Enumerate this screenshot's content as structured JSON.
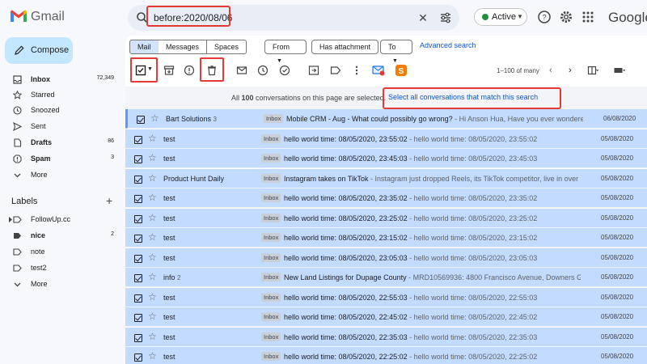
{
  "app": {
    "name": "Gmail",
    "google_wordmark": "Google"
  },
  "search": {
    "value": "before:2020/08/06"
  },
  "status": {
    "label": "Active"
  },
  "sidebar": {
    "compose_label": "Compose",
    "items": [
      {
        "label": "Inbox",
        "count": "72,349",
        "bold": true,
        "icon": "inbox-icon"
      },
      {
        "label": "Starred",
        "count": "",
        "bold": false,
        "icon": "star-icon"
      },
      {
        "label": "Snoozed",
        "count": "",
        "bold": false,
        "icon": "clock-icon"
      },
      {
        "label": "Sent",
        "count": "",
        "bold": false,
        "icon": "send-icon"
      },
      {
        "label": "Drafts",
        "count": "86",
        "bold": true,
        "icon": "draft-icon"
      },
      {
        "label": "Spam",
        "count": "3",
        "bold": true,
        "icon": "spam-icon"
      },
      {
        "label": "More",
        "count": "",
        "bold": false,
        "icon": "chevron-down-icon"
      }
    ],
    "labels_title": "Labels",
    "labels": [
      {
        "label": "FollowUp.cc",
        "count": "",
        "bold": false
      },
      {
        "label": "nice",
        "count": "2",
        "bold": true
      },
      {
        "label": "note",
        "count": "",
        "bold": false
      },
      {
        "label": "test2",
        "count": "",
        "bold": false
      },
      {
        "label": "More",
        "count": "",
        "bold": false
      }
    ]
  },
  "tabs": {
    "mail": "Mail",
    "messages": "Messages",
    "spaces": "Spaces"
  },
  "filters": {
    "from": "From",
    "has_attachment": "Has attachment",
    "to": "To",
    "advanced": "Advanced search"
  },
  "pager": {
    "text": "1–100 of many"
  },
  "banner": {
    "prefix": "All ",
    "count": "100",
    "suffix": " conversations on this page are selected.",
    "link": "Select all conversations that match this search"
  },
  "rows": [
    {
      "sender": "Bart Solutions",
      "count": "3",
      "label": "Inbox",
      "subject": "Mobile CRM - Aug - What could possibly go wrong?",
      "snippet": " - Hi Anson Hua, Have you ever wondered ...",
      "date": "06/08/2020"
    },
    {
      "sender": "test",
      "count": "",
      "label": "Inbox",
      "subject": "hello world time: 08/05/2020, 23:55:02",
      "snippet": " - hello world time: 08/05/2020, 23:55:02",
      "date": "05/08/2020"
    },
    {
      "sender": "test",
      "count": "",
      "label": "Inbox",
      "subject": "hello world time: 08/05/2020, 23:45:03",
      "snippet": " - hello world time: 08/05/2020, 23:45:03",
      "date": "05/08/2020"
    },
    {
      "sender": "Product Hunt Daily",
      "count": "",
      "label": "Inbox",
      "subject": "Instagram takes on TikTok",
      "snippet": " - Instagram just dropped Reels, its TikTok competitor, live in over ...",
      "date": "05/08/2020"
    },
    {
      "sender": "test",
      "count": "",
      "label": "Inbox",
      "subject": "hello world time: 08/05/2020, 23:35:02",
      "snippet": " - hello world time: 08/05/2020, 23:35:02",
      "date": "05/08/2020"
    },
    {
      "sender": "test",
      "count": "",
      "label": "Inbox",
      "subject": "hello world time: 08/05/2020, 23:25:02",
      "snippet": " - hello world time: 08/05/2020, 23:25:02",
      "date": "05/08/2020"
    },
    {
      "sender": "test",
      "count": "",
      "label": "Inbox",
      "subject": "hello world time: 08/05/2020, 23:15:02",
      "snippet": " - hello world time: 08/05/2020, 23:15:02",
      "date": "05/08/2020"
    },
    {
      "sender": "test",
      "count": "",
      "label": "Inbox",
      "subject": "hello world time: 08/05/2020, 23:05:03",
      "snippet": " - hello world time: 08/05/2020, 23:05:03",
      "date": "05/08/2020"
    },
    {
      "sender": "info",
      "count": "2",
      "label": "Inbox",
      "subject": "New Land Listings for Dupage County",
      "snippet": " - MRD10569936: 4800 Francisco Avenue, Downers Gro...",
      "date": "05/08/2020"
    },
    {
      "sender": "test",
      "count": "",
      "label": "Inbox",
      "subject": "hello world time: 08/05/2020, 22:55:03",
      "snippet": " - hello world time: 08/05/2020, 22:55:03",
      "date": "05/08/2020"
    },
    {
      "sender": "test",
      "count": "",
      "label": "Inbox",
      "subject": "hello world time: 08/05/2020, 22:45:02",
      "snippet": " - hello world time: 08/05/2020, 22:45:02",
      "date": "05/08/2020"
    },
    {
      "sender": "test",
      "count": "",
      "label": "Inbox",
      "subject": "hello world time: 08/05/2020, 22:35:03",
      "snippet": " - hello world time: 08/05/2020, 22:35:03",
      "date": "05/08/2020"
    },
    {
      "sender": "test",
      "count": "",
      "label": "Inbox",
      "subject": "hello world time: 08/05/2020, 22:25:02",
      "snippet": " - hello world time: 08/05/2020, 22:25:02",
      "date": "05/08/2020"
    }
  ],
  "colors": {
    "accent": "#0b57d0",
    "highlight": "#e53935",
    "selected_row": "#c2dbff",
    "compose": "#c2e7ff"
  }
}
